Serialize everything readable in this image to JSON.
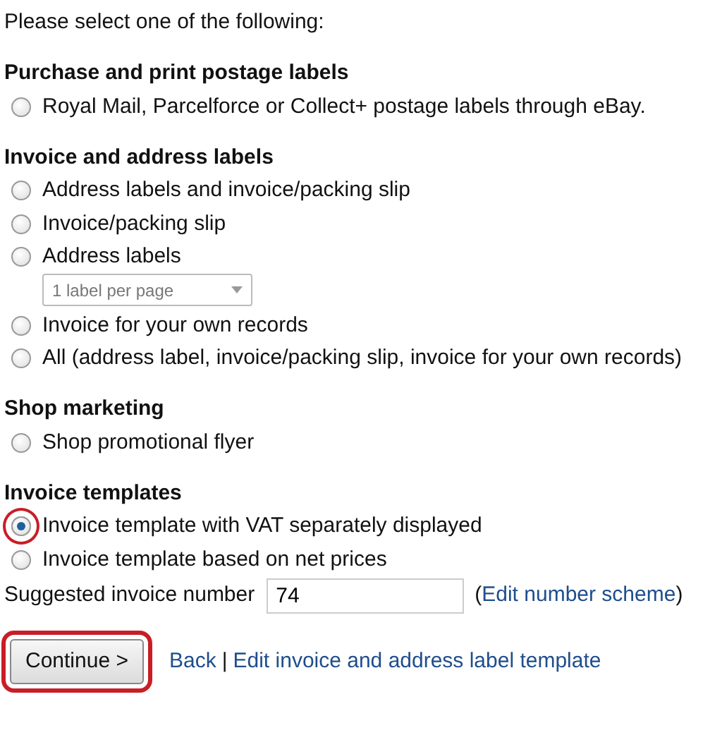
{
  "intro": "Please select one of the following:",
  "sections": [
    {
      "title": "Purchase and print postage labels",
      "options": [
        {
          "label": "Royal Mail, Parcelforce or Collect+ postage labels through eBay.",
          "selected": false,
          "highlighted": false
        }
      ]
    },
    {
      "title": "Invoice and address labels",
      "options": [
        {
          "label": "Address labels and invoice/packing slip",
          "selected": false,
          "highlighted": false
        },
        {
          "label": "Invoice/packing slip",
          "selected": false,
          "highlighted": false
        },
        {
          "label": "Address labels",
          "selected": false,
          "highlighted": false,
          "dropdown": {
            "value": "1 label per page",
            "disabled": true
          }
        },
        {
          "label": "Invoice for your own records",
          "selected": false,
          "highlighted": false
        },
        {
          "label": "All (address label, invoice/packing slip, invoice for your own records)",
          "selected": false,
          "highlighted": false
        }
      ]
    },
    {
      "title": "Shop marketing",
      "options": [
        {
          "label": "Shop promotional flyer",
          "selected": false,
          "highlighted": false
        }
      ]
    },
    {
      "title": "Invoice templates",
      "options": [
        {
          "label": "Invoice template with VAT separately displayed",
          "selected": true,
          "highlighted": true
        },
        {
          "label": "Invoice template based on net prices",
          "selected": false,
          "highlighted": false
        }
      ]
    }
  ],
  "invoice_number": {
    "label": "Suggested invoice number",
    "value": "74",
    "open": "(",
    "link": "Edit number scheme",
    "close": ")"
  },
  "footer": {
    "continue": {
      "label": "Continue >",
      "highlighted": true
    },
    "links": [
      "Back",
      "Edit invoice and address label template"
    ],
    "separator": "|"
  }
}
